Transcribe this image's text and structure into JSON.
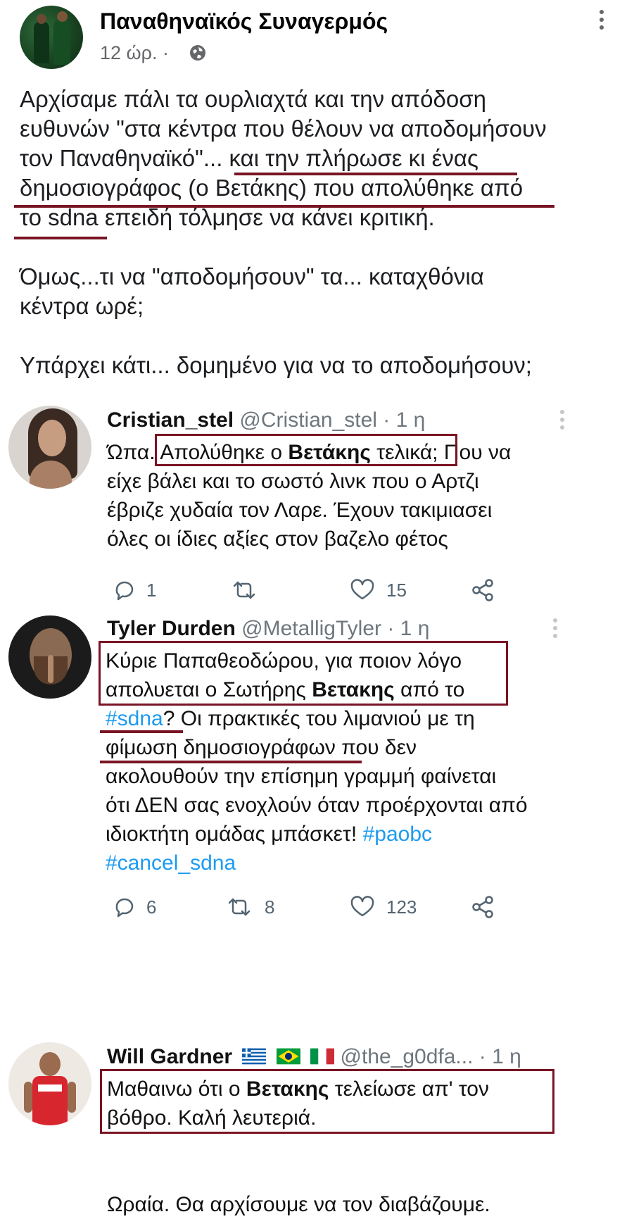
{
  "post": {
    "page_name": "Παναθηναϊκός Συναγερμός",
    "time": "12 ώρ. ·",
    "lines": [
      "Αρχίσαμε πάλι τα ουρλιαχτά και την απόδοση",
      "ευθυνών \"στα κέντρα που θέλουν να αποδομήσουν",
      "τον Παναθηναϊκό\"... και την πλήρωσε κι ένας",
      "δημοσιογράφος (ο Βετάκης) που απολύθηκε από",
      "το sdna επειδή τόλμησε να κάνει κριτική.",
      "",
      "Όμως...τι να \"αποδομήσουν\" τα... καταχθόνια",
      "κέντρα ωρέ;",
      "",
      "Υπάρχει κάτι... δομημένο για να το αποδομήσουν;"
    ]
  },
  "tweets": [
    {
      "name": "Cristian_stel",
      "handle": "@Cristian_stel",
      "time": "· 1 η",
      "line1_pre": "Ώπα. ",
      "line1_hl_a": "Απολύθηκε ο ",
      "line1_bold": "Βετάκης",
      "line1_hl_b": " τελικά;",
      "line1_post": " Που να",
      "lines": [
        "είχε βάλει και το σωστό λινκ που ο Αρτζι",
        "έβριζε χυδαία τον Λαρε. Έχουν τακιμιασει",
        "όλες οι ίδιες αξίες στον βαζελο φέτος"
      ],
      "replies": "1",
      "retweets": "",
      "likes": "15"
    },
    {
      "name": "Tyler Durden",
      "handle": "@MetalligTyler",
      "time": "· 1 η",
      "line1": "Κύριε Παπαθεοδώρου, για ποιον  λόγο",
      "line2_pre": "απολυεται ο Σωτήρης ",
      "line2_bold": "Βετακης",
      "line2_post": " από το",
      "line3_tag": "#sdna",
      "line3_post": "? Οι πρακτικές του λιμανιού με τη",
      "line4": "φίμωση δημοσιογράφων που δεν",
      "line5": "ακολουθούν την επίσημη γραμμή  φαίνεται",
      "line6": "ότι ΔΕΝ σας ενοχλούν όταν προέρχονται από",
      "line7_pre": "ιδιοκτήτη ομάδας μπάσκετ! ",
      "line7_tag": "#paobc",
      "line8_tag": "#cancel_sdna",
      "replies": "6",
      "retweets": "8",
      "likes": "123"
    },
    {
      "name": "Will Gardner",
      "handle": "@the_g0dfa...",
      "time": "· 1 η",
      "line1_pre": "Μαθαινω ότι ο ",
      "line1_bold": "Βετακης",
      "line1_post": " τελείωσε απ' τον",
      "line2": "βόθρο. Καλή λευτεριά.",
      "line3": "Ωραία. Θα αρχίσουμε να τον διαβάζουμε."
    }
  ],
  "colors": {
    "highlight": "#7a1424",
    "link": "#1d9bf0",
    "secondary_text": "#65676b"
  },
  "icons": [
    "globe-icon",
    "more-dots-icon",
    "reply-icon",
    "retweet-icon",
    "like-icon",
    "share-icon",
    "greece-flag-icon",
    "brazil-flag-icon",
    "italy-flag-icon"
  ]
}
